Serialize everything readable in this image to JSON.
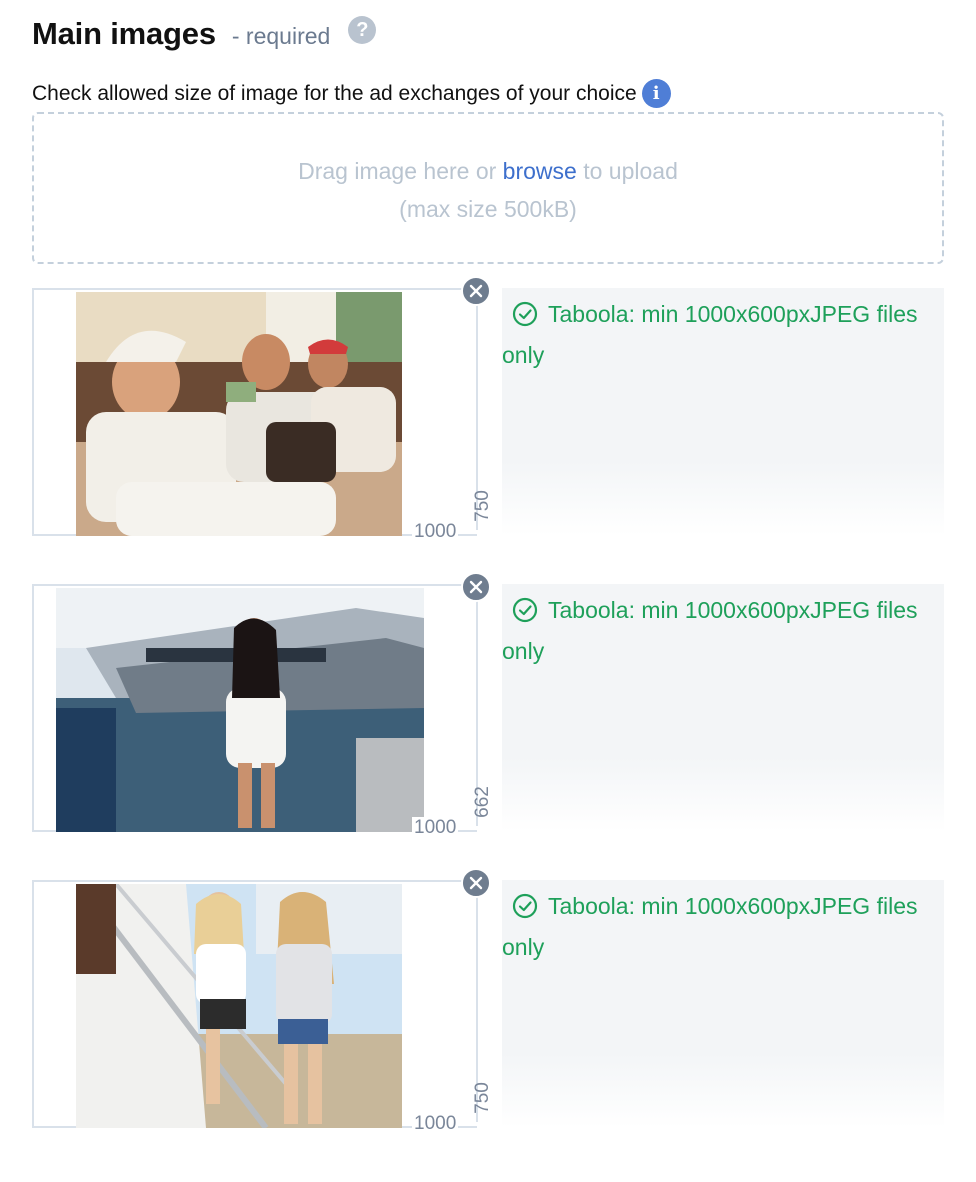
{
  "header": {
    "title": "Main images",
    "required_label": "- required",
    "help_icon": "question-circle-icon"
  },
  "instructions": {
    "text": "Check allowed size of image for the ad exchanges of your choice",
    "info_icon": "info-circle-icon"
  },
  "dropzone": {
    "text_before": "Drag image here or",
    "browse_label": "browse",
    "text_after": "to upload",
    "max_size": "(max size 500kB)"
  },
  "images": [
    {
      "width_label": "1000",
      "height_label": "750",
      "status": "Taboola: min 1000x600pxJPEG files only",
      "status_icon": "check-circle-icon",
      "remove_icon": "close-icon"
    },
    {
      "width_label": "1000",
      "height_label": "662",
      "status": "Taboola: min 1000x600pxJPEG files only",
      "status_icon": "check-circle-icon",
      "remove_icon": "close-icon"
    },
    {
      "width_label": "1000",
      "height_label": "750",
      "status": "Taboola: min 1000x600pxJPEG files only",
      "status_icon": "check-circle-icon",
      "remove_icon": "close-icon"
    }
  ],
  "colors": {
    "accent_link": "#3d6fcc",
    "success_green": "#1ea05a",
    "info_blue": "#4f7ed6",
    "remove_gray": "#6f7d8f"
  }
}
